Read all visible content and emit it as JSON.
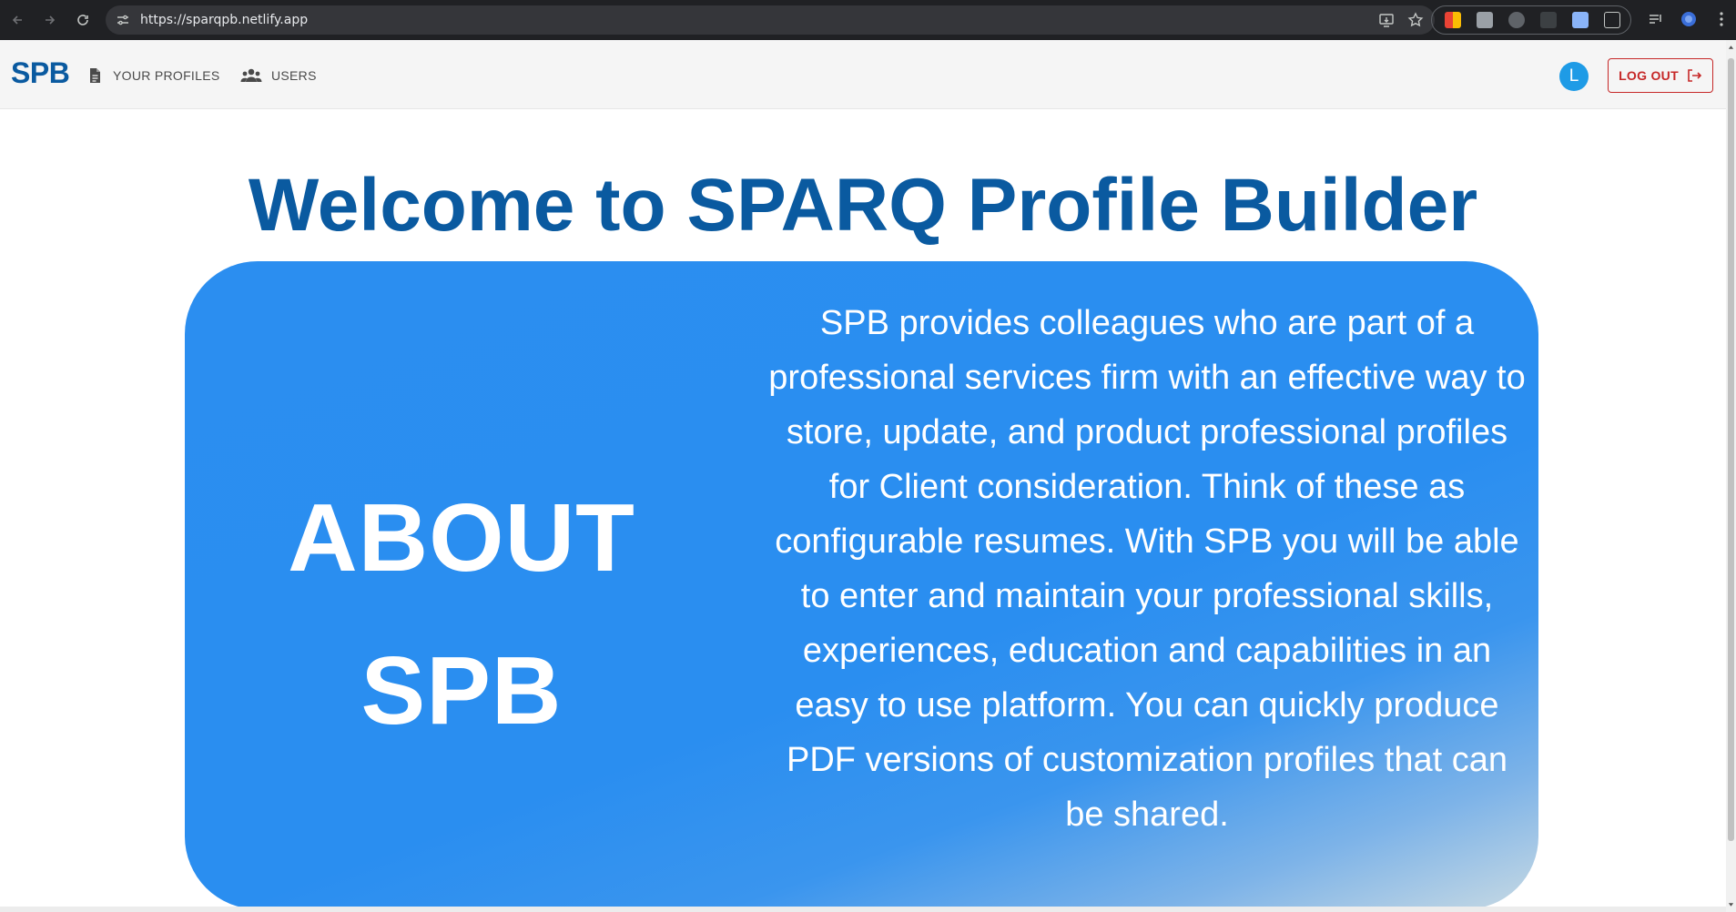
{
  "browser": {
    "url": "https://sparqpb.netlify.app"
  },
  "header": {
    "logo": "SPB",
    "nav": [
      {
        "label": "YOUR PROFILES",
        "icon": "document-icon"
      },
      {
        "label": "USERS",
        "icon": "users-icon"
      }
    ],
    "avatar_initial": "L",
    "logout_label": "LOG OUT"
  },
  "main": {
    "welcome_prefix": "Welcome to ",
    "welcome_brand": "SPARQ Profile Builder",
    "about_title_line1": "ABOUT",
    "about_title_line2": "SPB",
    "about_text": "SPB provides colleagues who are part of a professional services firm with an effective way to store, update, and product professional profiles for Client consideration. Think of these as configurable resumes. With SPB you will be able to enter and maintain your professional skills, experiences, education and capabilities in an easy to use platform. You can quickly produce PDF versions of customization profiles that can be shared."
  },
  "colors": {
    "brand": "#0a5aa0",
    "card": "#2b8ef0",
    "logout": "#c62828",
    "avatar": "#1e9be6"
  }
}
